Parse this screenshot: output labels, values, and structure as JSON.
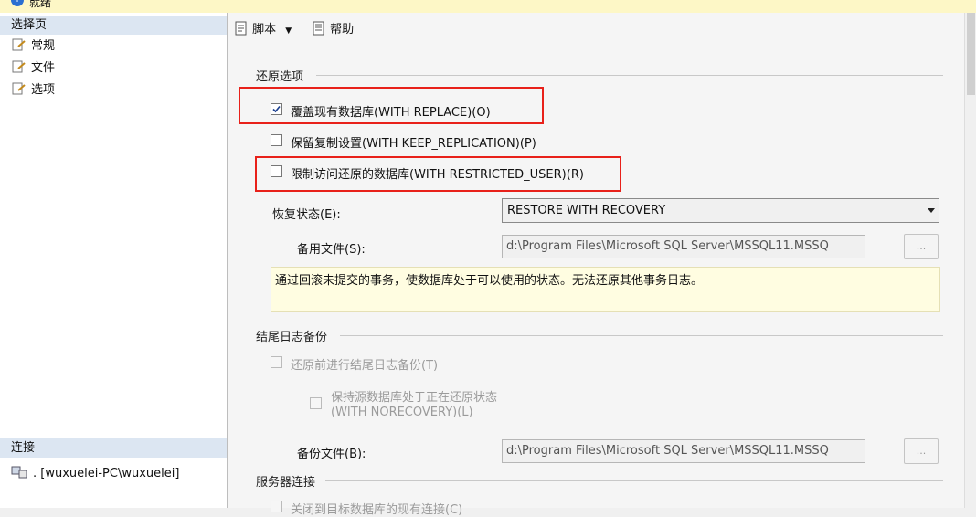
{
  "window": {
    "title_fragment": "就绪"
  },
  "sidebar": {
    "pages_header": "选择页",
    "items": [
      {
        "label": "常规",
        "icon": "page-wrench-icon"
      },
      {
        "label": "文件",
        "icon": "page-wrench-icon"
      },
      {
        "label": "选项",
        "icon": "page-wrench-icon"
      }
    ],
    "connection_header": "连接",
    "connection_value": ". [wuxuelei-PC\\wuxuelei]"
  },
  "toolbar": {
    "script_label": "脚本",
    "help_label": "帮助"
  },
  "restore_options": {
    "group_title": "还原选项",
    "overwrite": {
      "label": "覆盖现有数据库(WITH REPLACE)(O)",
      "checked": true
    },
    "keep_replication": {
      "label": "保留复制设置(WITH KEEP_REPLICATION)(P)",
      "checked": false
    },
    "restricted_user": {
      "label": "限制访问还原的数据库(WITH RESTRICTED_USER)(R)",
      "checked": false
    },
    "recovery_state_label": "恢复状态(E):",
    "recovery_state_value": "RESTORE WITH RECOVERY",
    "standby_file_label": "备用文件(S):",
    "standby_file_value": "d:\\Program Files\\Microsoft SQL Server\\MSSQL11.MSSQ",
    "browse_label": "...",
    "description": "通过回滚未提交的事务，使数据库处于可以使用的状态。无法还原其他事务日志。"
  },
  "tail_log": {
    "group_title": "结尾日志备份",
    "backup_before_restore": {
      "label": "还原前进行结尾日志备份(T)",
      "checked": false
    },
    "leave_restoring_line1": "保持源数据库处于正在还原状态",
    "leave_restoring_line2": "(WITH NORECOVERY)(L)",
    "backup_file_label": "备份文件(B):",
    "backup_file_value": "d:\\Program Files\\Microsoft SQL Server\\MSSQL11.MSSQ",
    "browse_label": "..."
  },
  "server_connections": {
    "group_title": "服务器连接",
    "cut_off_label": "关闭到目标数据库的现有连接(C)"
  },
  "colors": {
    "highlight": "#e8211a",
    "header_bg": "#dce6f2",
    "info_bg": "#fffde1"
  }
}
